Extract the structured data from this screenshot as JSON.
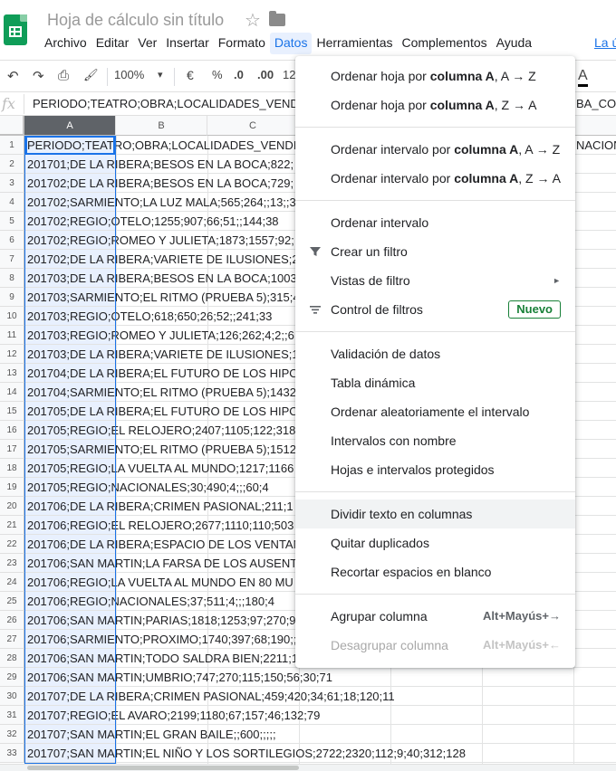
{
  "app": {
    "doc_title": "Hoja de cálculo sin título",
    "star_icon": "☆",
    "menu": [
      "Archivo",
      "Editar",
      "Ver",
      "Insertar",
      "Formato",
      "Datos",
      "Herramientas",
      "Complementos",
      "Ayuda"
    ],
    "active_menu": "Datos",
    "last_edit_link": "La ú"
  },
  "toolbar": {
    "undo": "↶",
    "redo": "↷",
    "print": "⎙",
    "paint": "🖌",
    "zoom": "100%",
    "zoom_caret": "▾",
    "currency": "€",
    "percent": "%",
    "dec_less": ".0",
    "dec_more": ".00",
    "more_formats": "12",
    "text_color": "A"
  },
  "formula_bar": {
    "fx": "fx",
    "content": "PERIODO;TEATRO;OBRA;LOCALIDADES_VENDIDAS",
    "content_tail": "BA_CON"
  },
  "grid": {
    "columns": [
      "A",
      "B",
      "C"
    ],
    "rows": [
      {
        "n": "1",
        "text": "PERIODO;TEATRO;OBRA;LOCALIDADES_VENDI"
      },
      {
        "n": "2",
        "text": "201701;DE LA RIBERA;BESOS EN LA BOCA;822;"
      },
      {
        "n": "3",
        "text": "201702;DE LA RIBERA;BESOS EN LA BOCA;729;"
      },
      {
        "n": "4",
        "text": "201702;SARMIENTO;LA LUZ MALA;565;264;;13;;3"
      },
      {
        "n": "5",
        "text": "201702;REGIO;OTELO;1255;907;66;51;;144;38"
      },
      {
        "n": "6",
        "text": "201702;REGIO;ROMEO Y JULIETA;1873;1557;92;"
      },
      {
        "n": "7",
        "text": "201702;DE LA RIBERA;VARIETE DE ILUSIONES;2"
      },
      {
        "n": "8",
        "text": "201703;DE LA RIBERA;BESOS EN LA BOCA;1003"
      },
      {
        "n": "9",
        "text": "201703;SARMIENTO;EL RITMO (PRUEBA 5);315;4"
      },
      {
        "n": "10",
        "text": "201703;REGIO;OTELO;618;650;26;52;;241;33"
      },
      {
        "n": "11",
        "text": "201703;REGIO;ROMEO Y JULIETA;126;262;4;2;;6"
      },
      {
        "n": "12",
        "text": "201703;DE LA RIBERA;VARIETE DE ILUSIONES;1"
      },
      {
        "n": "13",
        "text": "201704;DE LA RIBERA;EL FUTURO DE LOS HIPO"
      },
      {
        "n": "14",
        "text": "201704;SARMIENTO;EL RITMO (PRUEBA 5);1432"
      },
      {
        "n": "15",
        "text": "201705;DE LA RIBERA;EL FUTURO DE LOS HIPO"
      },
      {
        "n": "16",
        "text": "201705;REGIO;EL RELOJERO;2407;1105;122;318"
      },
      {
        "n": "17",
        "text": "201705;SARMIENTO;EL RITMO (PRUEBA 5);1512"
      },
      {
        "n": "18",
        "text": "201705;REGIO;LA VUELTA AL MUNDO;1217;1166"
      },
      {
        "n": "19",
        "text": "201705;REGIO;NACIONALES;30;490;4;;;60;4"
      },
      {
        "n": "20",
        "text": "201706;DE LA RIBERA;CRIMEN PASIONAL;211;1"
      },
      {
        "n": "21",
        "text": "201706;REGIO;EL RELOJERO;2677;1110;110;503"
      },
      {
        "n": "22",
        "text": "201706;DE LA RIBERA;ESPACIO DE LOS VENTAN"
      },
      {
        "n": "23",
        "text": "201706;SAN MARTIN;LA FARSA DE LOS AUSENT"
      },
      {
        "n": "24",
        "text": "201706;REGIO;LA VUELTA AL MUNDO EN 80 MU"
      },
      {
        "n": "25",
        "text": "201706;REGIO;NACIONALES;37;511;4;;;180;4"
      },
      {
        "n": "26",
        "text": "201706;SAN MARTIN;PARIAS;1818;1253;97;270;9"
      },
      {
        "n": "27",
        "text": "201706;SARMIENTO;PROXIMO;1740;397;68;190;;"
      },
      {
        "n": "28",
        "text": "201706;SAN MARTIN;TODO SALDRA BIEN;2211;1"
      },
      {
        "n": "29",
        "text": "201706;SAN MARTIN;UMBRIO;747;270;115;150;56;30;71"
      },
      {
        "n": "30",
        "text": "201707;DE LA RIBERA;CRIMEN PASIONAL;459;420;34;61;18;120;11"
      },
      {
        "n": "31",
        "text": "201707;REGIO;EL AVARO;2199;1180;67;157;46;132;79"
      },
      {
        "n": "32",
        "text": "201707;SAN MARTIN;EL GRAN BAILE;;600;;;;;"
      },
      {
        "n": "33",
        "text": "201707;SAN MARTIN;EL NIÑO Y LOS SORTILEGIOS;2722;2320;112;9;40;312;128"
      }
    ],
    "row1_overflow": "NACION"
  },
  "datos_menu": {
    "items": [
      {
        "pre": "Ordenar hoja por ",
        "bold": "columna A",
        "post": ", A → Z"
      },
      {
        "pre": "Ordenar hoja por ",
        "bold": "columna A",
        "post": ", Z → A"
      },
      {
        "pre": "Ordenar intervalo por ",
        "bold": "columna A",
        "post": ", A → Z"
      },
      {
        "pre": "Ordenar intervalo por ",
        "bold": "columna A",
        "post": ", Z → A"
      }
    ],
    "sort_range": "Ordenar intervalo",
    "create_filter": "Crear un filtro",
    "filter_views": "Vistas de filtro",
    "submenu_arrow": "►",
    "filter_controls": "Control de filtros",
    "new_badge": "Nuevo",
    "validation": "Validación de datos",
    "pivot": "Tabla dinámica",
    "randomize": "Ordenar aleatoriamente el intervalo",
    "named_ranges": "Intervalos con nombre",
    "protected": "Hojas e intervalos protegidos",
    "split_text": "Dividir texto en columnas",
    "remove_dupes": "Quitar duplicados",
    "trim": "Recortar espacios en blanco",
    "group_col": "Agrupar columna",
    "group_shortcut": "Alt+Mayús+→",
    "ungroup_col": "Desagrupar columna",
    "ungroup_shortcut": "Alt+Mayús+←"
  }
}
